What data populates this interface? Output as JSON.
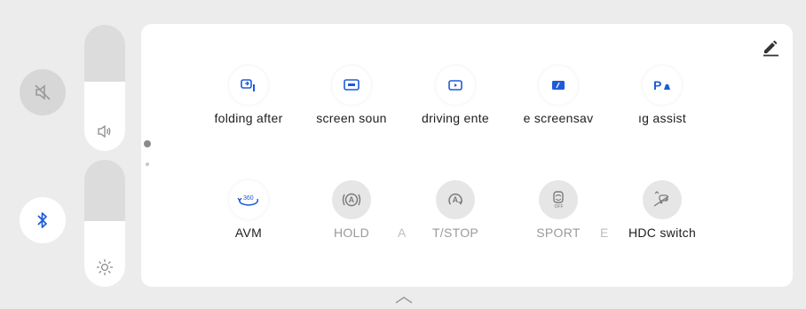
{
  "left_controls": {
    "mute_icon": "mute-speaker-icon",
    "volume_icon": "speaker-icon",
    "volume_level": 0.55,
    "bluetooth_icon": "bluetooth-icon",
    "brightness_icon": "sun-icon",
    "brightness_level": 0.52
  },
  "colors": {
    "accent": "#1e5bd8",
    "active_text": "#202020",
    "inactive_text": "#9a9a9a"
  },
  "pager": {
    "pages": 2,
    "current": 1
  },
  "row1": [
    {
      "label": "folding after",
      "icon": "folding-mirror-icon"
    },
    {
      "label": "screen soun",
      "icon": "screen-sound-icon"
    },
    {
      "label": "driving ente",
      "icon": "driving-entertainment-icon"
    },
    {
      "label": "e screensav",
      "icon": "screensaver-icon"
    },
    {
      "label": "ıg assist",
      "icon": "parking-assist-icon"
    }
  ],
  "row2": [
    {
      "label": "AVM",
      "icon": "avm-360-icon"
    },
    {
      "label": "HOLD",
      "icon": "auto-hold-icon"
    },
    {
      "label": "T/STOP",
      "icon": "auto-start-stop-icon"
    },
    {
      "label": "SPORT",
      "icon": "esp-sport-off-icon"
    },
    {
      "label": "HDC switch",
      "icon": "hdc-icon"
    }
  ],
  "row2_fragments": {
    "between_1_2": "A",
    "between_3_4": "E"
  }
}
